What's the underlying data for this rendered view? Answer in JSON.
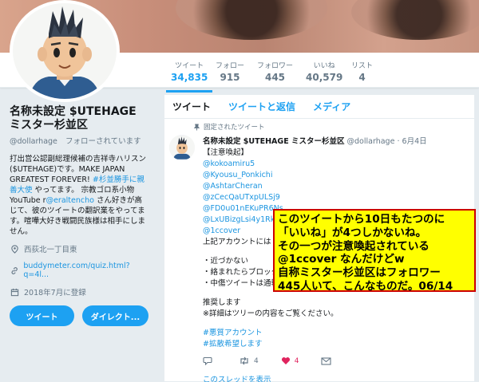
{
  "stats": [
    {
      "label": "ツイート",
      "value": "34,835",
      "active": true
    },
    {
      "label": "フォロー",
      "value": "915"
    },
    {
      "label": "フォロワー",
      "value": "445"
    },
    {
      "label": "いいね",
      "value": "40,579"
    },
    {
      "label": "リスト",
      "value": "4"
    }
  ],
  "profile": {
    "name": "名称未設定 $UTEHAGE ミスター杉並区",
    "handle": "@dollarhage",
    "follows_you": "フォローされています",
    "bio_1": "打出営公認副総理候補の吉祥寺ハリスン($UTEHAGE)です。MAKE JAPAN GREATEST FOREVER! ",
    "bio_tag": "#杉並勝手に親善大使",
    "bio_2": " やってます。 宗教ゴロ系小物YouTube r",
    "bio_mention": "@eraltencho",
    "bio_3": " さん好きが高じて、彼のツイートの翻訳業をやってます。喧嘩大好き戦闘民族様は相手にしません。",
    "location": "西荻北一丁目東",
    "website": "buddymeter.com/quiz.html?q=4l...",
    "joined": "2018年7月に登録",
    "tweet_button": "ツイート",
    "dm_button": "ダイレクト..."
  },
  "tabs": [
    "ツイート",
    "ツイートと返信",
    "メディア"
  ],
  "tweet": {
    "pinned": "固定されたツイート",
    "name": "名称未設定 $UTEHAGE ミスター杉並区",
    "handle": "@dollarhage",
    "date": "6月4日",
    "title": "【注意喚起】",
    "mentions": [
      "@kokoamiru5",
      "@Kyousu_Ponkichi",
      "@AshtarCheran",
      "@zCecQaUTxpULSj9",
      "@FD0u01nEKuPR6Ns",
      "@LxUBizgLsi4y1Rk",
      "@1ccover"
    ],
    "line_1": "上記アカウントには",
    "bullet_1": "・近づかない",
    "bullet_2": "・絡まれたらブロック",
    "bullet_3": "・中傷ツイートは通報",
    "line_2": "推奨します",
    "line_3": "※詳細はツリーの内容をご覧ください。",
    "tag_1": "#悪質アカウント",
    "tag_2": "#拡散希望します",
    "retweets": "4",
    "likes": "4",
    "thread": "このスレッドを表示"
  },
  "overlay": {
    "line_1": "このツイートから10日もたつのに",
    "line_2": "「いいね」が4つしかないね。",
    "line_3": "その一つが注意喚起されている",
    "line_4": " @1ccover なんだけどw",
    "line_5": "自称ミスター杉並区はフォロワー",
    "line_6": "445人いて、こんなものだ。06/14"
  },
  "colors": {
    "accent": "#1da1f2",
    "like": "#e0245e",
    "overlay_bg": "#ffff00",
    "overlay_border": "#cc0000"
  }
}
